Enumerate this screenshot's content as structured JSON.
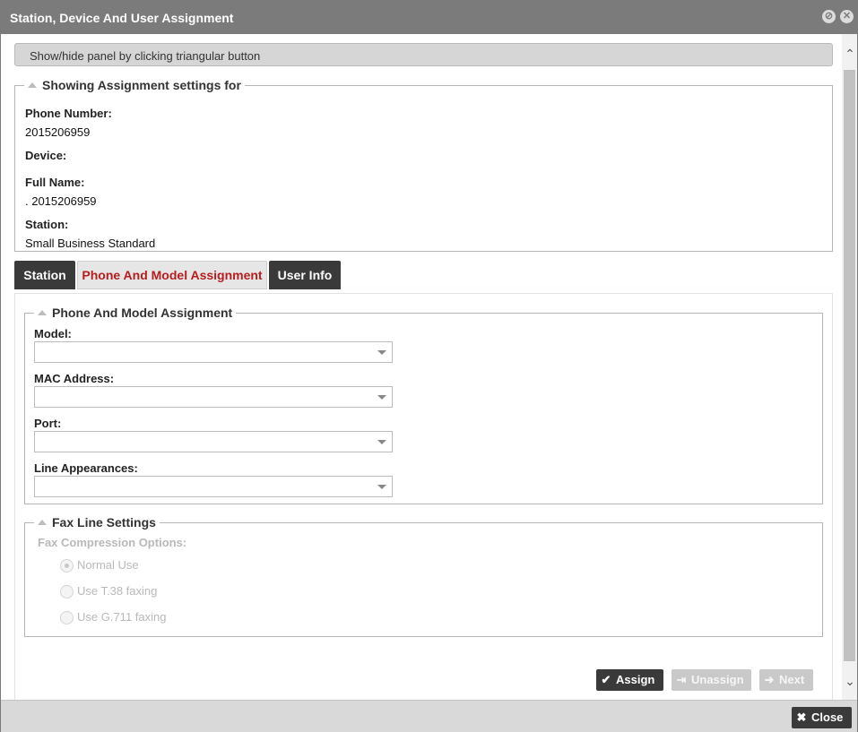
{
  "window": {
    "title": "Station, Device And User Assignment"
  },
  "hint": "Show/hide panel by clicking triangular button",
  "assignment": {
    "legend": "Showing Assignment settings for",
    "phone_label": "Phone Number:",
    "phone_value": "2015206959",
    "device_label": "Device:",
    "fullname_label": "Full Name:",
    "fullname_value": ". 2015206959",
    "station_label": "Station:",
    "station_value": "Small Business Standard"
  },
  "tabs": [
    {
      "label": "Station",
      "active": false
    },
    {
      "label": "Phone And Model Assignment",
      "active": true
    },
    {
      "label": "User Info",
      "active": false
    }
  ],
  "phone_model": {
    "legend": "Phone And Model Assignment",
    "model_label": "Model:",
    "model_value": "",
    "mac_label": "MAC Address:",
    "mac_value": "",
    "port_label": "Port:",
    "port_value": "",
    "line_label": "Line Appearances:",
    "line_value": ""
  },
  "fax": {
    "legend": "Fax Line Settings",
    "options_label": "Fax Compression Options:",
    "options": [
      {
        "label": "Normal Use",
        "checked": true
      },
      {
        "label": "Use T.38 faxing",
        "checked": false
      },
      {
        "label": "Use G.711 faxing",
        "checked": false
      }
    ]
  },
  "buttons": {
    "assign": "Assign",
    "unassign": "Unassign",
    "next": "Next",
    "close": "Close"
  },
  "colors": {
    "titlebar": "#7b7b7b",
    "active_tab_text": "#b71d1d",
    "dark_button": "#3a3a3a"
  }
}
